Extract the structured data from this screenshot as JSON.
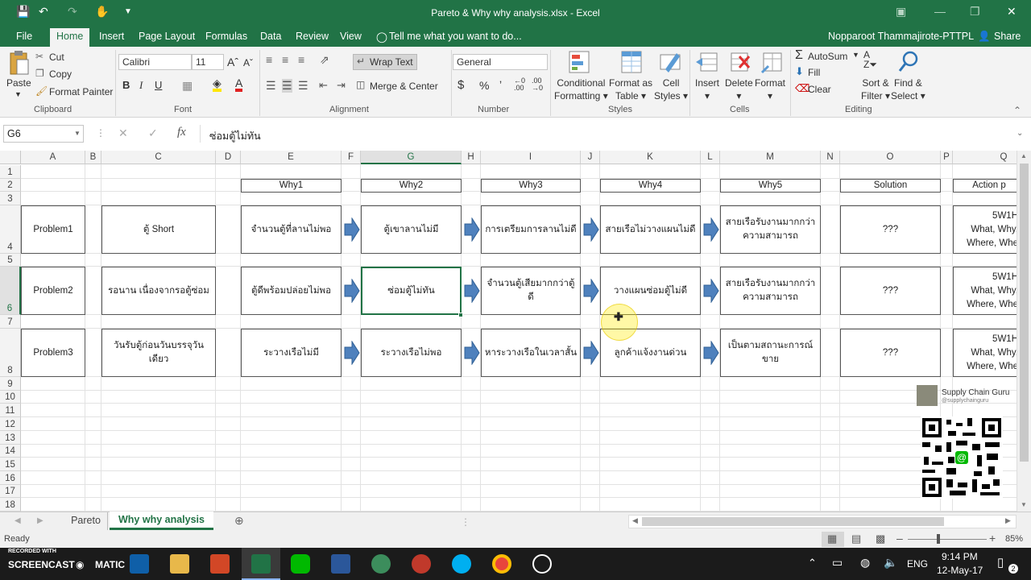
{
  "window": {
    "title": "Pareto & Why why analysis.xlsx - Excel"
  },
  "ribbon": {
    "tabs": [
      "File",
      "Home",
      "Insert",
      "Page Layout",
      "Formulas",
      "Data",
      "Review",
      "View"
    ],
    "tell_me": "Tell me what you want to do...",
    "user": "Nopparoot Thammajirote-PTTPL",
    "share": "Share",
    "clipboard": {
      "paste": "Paste",
      "cut": "Cut",
      "copy": "Copy",
      "format_painter": "Format Painter",
      "label": "Clipboard"
    },
    "font": {
      "name": "Calibri",
      "size": "11",
      "label": "Font"
    },
    "alignment": {
      "wrap_text": "Wrap Text",
      "merge_center": "Merge & Center",
      "label": "Alignment"
    },
    "number": {
      "format": "General",
      "label": "Number"
    },
    "styles": {
      "conditional": "Conditional",
      "formatting": "Formatting",
      "format_as": "Format as",
      "table": "Table",
      "cell": "Cell",
      "styles_btn": "Styles",
      "label": "Styles"
    },
    "cells": {
      "insert": "Insert",
      "delete": "Delete",
      "format": "Format",
      "label": "Cells"
    },
    "editing": {
      "autosum": "AutoSum",
      "fill": "Fill",
      "clear": "Clear",
      "sort": "Sort &",
      "filter": "Filter",
      "find": "Find &",
      "select": "Select",
      "label": "Editing"
    }
  },
  "formula_bar": {
    "name_box": "G6",
    "formula": "ซ่อมตู้ไม่ทัน"
  },
  "columns": [
    "A",
    "B",
    "C",
    "D",
    "E",
    "F",
    "G",
    "H",
    "I",
    "J",
    "K",
    "L",
    "M",
    "N",
    "O",
    "P",
    "Q"
  ],
  "rows": [
    "1",
    "2",
    "3",
    "4",
    "5",
    "6",
    "7",
    "8",
    "9",
    "10",
    "11",
    "12",
    "13",
    "14",
    "15",
    "16",
    "17",
    "18"
  ],
  "headers": [
    "Why1",
    "Why2",
    "Why3",
    "Why4",
    "Why5",
    "Solution",
    "Action p"
  ],
  "problems": [
    {
      "label": "Problem1",
      "cause": "ตู้ Short",
      "why": [
        "จำนวนตู้ที่ลานไม่พอ",
        "ตู้เขาลานไม่มี",
        "การเตรียมการลานไม่ดี",
        "สายเรือไม่วางแผนไม่ดี",
        "สายเรือรับงานมากกว่าความสามารถ"
      ],
      "solution": "???",
      "action": [
        "5W1H",
        "What, Why,",
        "Where, Whe"
      ]
    },
    {
      "label": "Problem2",
      "cause": "รอนาน เนื่องจากรอตู้ซ่อม",
      "why": [
        "ตู้ดีพร้อมปล่อยไม่พอ",
        "ซ่อมตู้ไม่ทัน",
        "จำนวนตู้เสียมากกว่าตู้ดี",
        "วางแผนซ่อมตู้ไม่ดี",
        "สายเรือรับงานมากกว่าความสามารถ"
      ],
      "solution": "???",
      "action": [
        "5W1H",
        "What, Why,",
        "Where, Whe"
      ]
    },
    {
      "label": "Problem3",
      "cause": "วันรับตู้ก่อนวันบรรจุวันเดียว",
      "why": [
        "ระวางเรือไม่มี",
        "ระวางเรือไม่พอ",
        "หาระวางเรือในเวลาสั้น",
        "ลูกค้าแจ้งงานด่วน",
        "เป็นตามสถานะการณ์ขาย"
      ],
      "solution": "???",
      "action": [
        "5W1H",
        "What, Why,",
        "Where, Whe"
      ]
    }
  ],
  "sheets": [
    "Pareto",
    "Why why analysis"
  ],
  "status": {
    "ready": "Ready",
    "zoom": "85%"
  },
  "watermark": {
    "name": "Supply Chain Guru",
    "handle": "@supplychainguru"
  },
  "recorder": {
    "line1": "RECORDED WITH",
    "line2": "SCREENCAST",
    "line3": "MATIC"
  },
  "taskbar": {
    "lang": "ENG",
    "time": "9:14 PM",
    "date": "12-May-17",
    "notifications": "2"
  },
  "colors": {
    "excel_green": "#217346",
    "arrow_blue": "#4f81bd"
  }
}
